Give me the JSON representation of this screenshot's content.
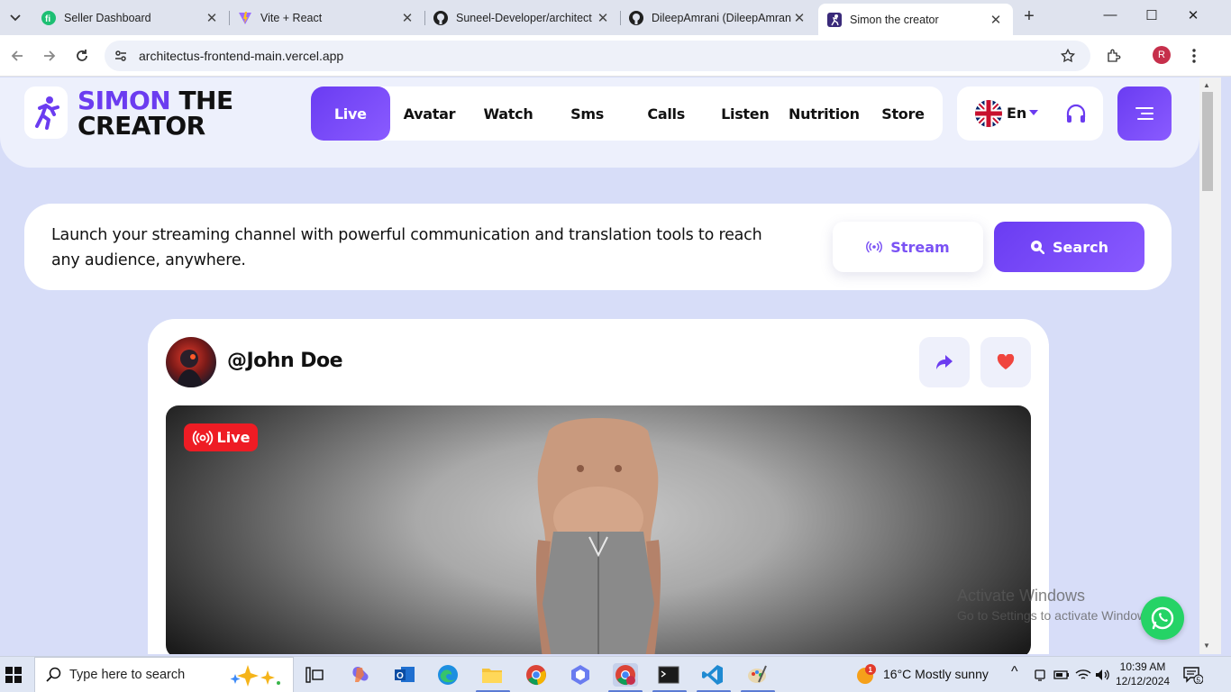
{
  "browser": {
    "tabs": [
      {
        "title": "Seller Dashboard",
        "icon": "fiverr-icon",
        "active": false
      },
      {
        "title": "Vite + React",
        "icon": "vite-icon",
        "active": false
      },
      {
        "title": "Suneel-Developer/architect",
        "icon": "github-icon",
        "active": false
      },
      {
        "title": "DileepAmrani (DileepAmran",
        "icon": "github-icon",
        "active": false
      },
      {
        "title": "Simon the creator",
        "icon": "site-icon",
        "active": true
      }
    ],
    "url": "architectus-frontend-main.vercel.app",
    "profile_initial": "R"
  },
  "site": {
    "logo_accent": "SIMON",
    "logo_rest_1": "THE",
    "logo_rest_2": "CREATOR",
    "nav": [
      {
        "label": "Live",
        "active": true
      },
      {
        "label": "Avatar",
        "active": false
      },
      {
        "label": "Watch",
        "active": false
      },
      {
        "label": "Sms",
        "active": false
      },
      {
        "label": "Calls",
        "active": false
      },
      {
        "label": "Listen",
        "active": false
      },
      {
        "label": "Nutrition",
        "active": false
      },
      {
        "label": "Store",
        "active": false
      }
    ],
    "language": "En",
    "accent_color": "#6b3cf0"
  },
  "hero": {
    "text": "Launch your streaming channel with powerful communication and translation tools to reach any audience, anywhere.",
    "stream_label": "Stream",
    "search_label": "Search"
  },
  "stream_card": {
    "username": "@John Doe",
    "live_label": "Live"
  },
  "watermark": {
    "line1": "Activate Windows",
    "line2": "Go to Settings to activate Windows."
  },
  "taskbar": {
    "search_placeholder": "Type here to search",
    "weather": "16°C  Mostly sunny",
    "weather_badge": "1",
    "time": "10:39 AM",
    "date": "12/12/2024",
    "notification_count": "5"
  }
}
